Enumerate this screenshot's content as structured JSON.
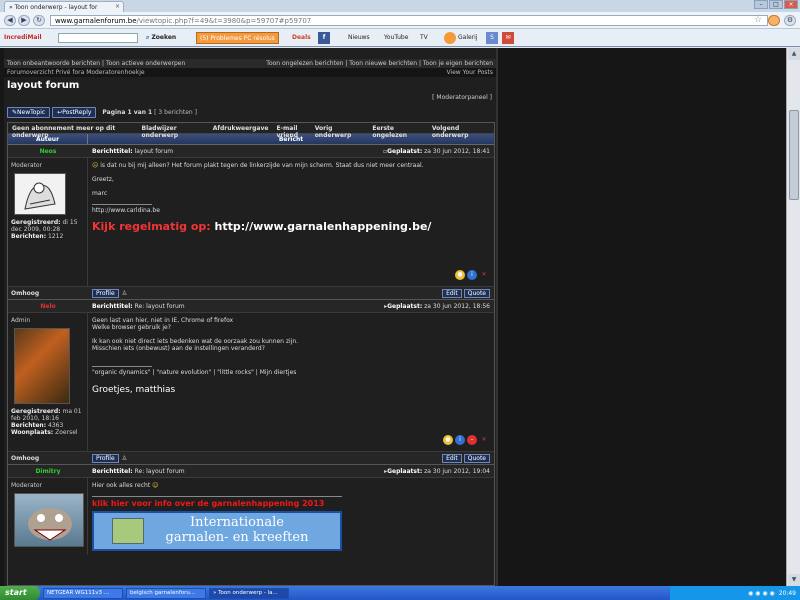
{
  "browser": {
    "tab_title": "» Toon onderwerp - layout for",
    "url_domain": "www.garnalenforum.be",
    "url_path": "/viewtopic.php?f=49&t=3980&p=59707#p59707",
    "toolbar": {
      "incredimail": "IncrediMail",
      "zoeken": "Zoeken",
      "problemes": "(5) Problemes PC résolus",
      "deals": "Deals",
      "nieuws": "Nieuws",
      "youtube": "YouTube",
      "tv": "TV",
      "galerij": "Galerij"
    }
  },
  "forum": {
    "topbar_left": "Toon onbeantwoorde berichten | Toon actieve onderwerpen",
    "topbar_right": "Toon ongelezen berichten | Toon nieuwe berichten | Toon je eigen berichten",
    "nav_left": "Forumoverzicht  Privé fora  Moderatorenhoekje",
    "nav_right": "View Your Posts",
    "title": "layout forum",
    "moderator_panel": "[ Moderatorpaneel ]",
    "new_topic": "NewTopic",
    "post_reply": "PostReply",
    "page_info_bold": "Pagina 1 van 1",
    "page_info_rest": "[ 3 berichten ]",
    "topic_nav_left": [
      "Geen abonnement meer op dit onderwerp",
      "Bladwijzer onderwerp",
      "Afdrukweergave",
      "E-mail vriend"
    ],
    "topic_nav_right": [
      "Vorig onderwerp",
      "Eerste ongelezen",
      "Volgend onderwerp"
    ],
    "header_author": "Auteur",
    "header_message": "Bericht",
    "omhoog": "Omhoog",
    "profile": "Profile",
    "edit": "Edit",
    "quote": "Quote",
    "posts": [
      {
        "author": "Neos",
        "author_color": "#2fd02f",
        "subject_label": "Berichttitel:",
        "subject": "layout forum",
        "posted_label": "Geplaatst:",
        "posted": "za 30 jun 2012, 18:41",
        "rank": "Moderator",
        "reg_label": "Geregistreerd:",
        "reg_value": "di 15 dec 2009, 00:28",
        "posts_label": "Berichten:",
        "posts_value": "1212",
        "body": [
          "is dat nu bij mij alleen? Het forum plakt tegen de linkerzijde van mijn scherm. Staat dus niet meer centraal.",
          "Greetz,",
          "marc"
        ],
        "signature_url": "http://www.carldina.be",
        "kijk_red": "Kijk regelmatig op:",
        "kijk_white": "http://www.garnalenhappening.be/"
      },
      {
        "author": "Nelo",
        "author_color": "#e03030",
        "subject_label": "Berichttitel:",
        "subject": "Re: layout forum",
        "posted_label": "Geplaatst:",
        "posted": "za 30 jun 2012, 18:56",
        "rank": "Admin",
        "reg_label": "Geregistreerd:",
        "reg_value": "ma 01 feb 2010, 18:16",
        "posts_label": "Berichten:",
        "posts_value": "4363",
        "loc_label": "Woonplaats:",
        "loc_value": "Zoersel",
        "body_lines": [
          "Geen last van hier, niet in IE, Chrome of firefox",
          "Welke browser gebruik je?",
          "",
          "Ik kan ook niet direct iets bedenken wat de oorzaak zou kunnen zijn.",
          "Misschien iets (onbewust) aan de instellingen veranderd?"
        ],
        "signature": "\"organic dynamics\" | \"nature evolution\" | \"little rocks\" | Mijn diertjes",
        "groetjes": "Groetjes, matthias"
      },
      {
        "author": "Dimitry",
        "author_color": "#2fd02f",
        "subject_label": "Berichttitel:",
        "subject": "Re: layout forum",
        "posted_label": "Geplaatst:",
        "posted": "za 30 jun 2012, 19:04",
        "rank": "Moderator",
        "body": "Hier ook alles recht",
        "klik": "klik hier voor info over de garnalenhappening 2013",
        "banner_line1": "Internationale",
        "banner_line2": "garnalen- en kreeften"
      }
    ]
  },
  "taskbar": {
    "start": "start",
    "tasks": [
      "NETGEAR WG111v3 ...",
      "belgisch garnalenforu...",
      "» Toon onderwerp - la..."
    ],
    "clock": "20:49"
  }
}
